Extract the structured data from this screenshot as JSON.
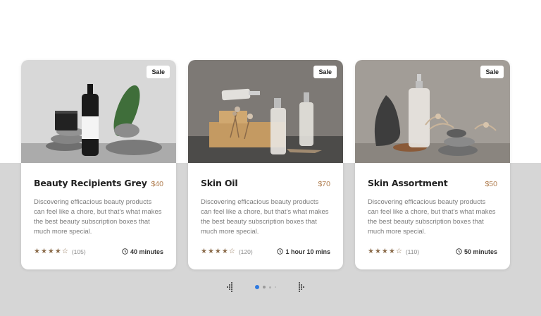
{
  "products": [
    {
      "title": "Beauty Recipients Grey",
      "price": "$40",
      "badge": "Sale",
      "description": "Discovering efficacious beauty products can feel like a chore, but that’s what makes the best beauty subscription boxes that much more special.",
      "stars": "★★★★☆",
      "rating_value": 4,
      "reviews": "(105)",
      "duration": "40 minutes"
    },
    {
      "title": "Skin Oil",
      "price": "$70",
      "badge": "Sale",
      "description": "Discovering efficacious beauty products can feel like a chore, but that’s what makes the best beauty subscription boxes that much more special.",
      "stars": "★★★★☆",
      "rating_value": 4,
      "reviews": "(120)",
      "duration": "1 hour 10 mins"
    },
    {
      "title": "Skin Assortment",
      "price": "$50",
      "badge": "Sale",
      "description": "Discovering efficacious beauty products can feel like a chore, but that’s what makes the best beauty subscription boxes that much more special.",
      "stars": "★★★★☆",
      "rating_value": 4,
      "reviews": "(110)",
      "duration": "50 minutes"
    }
  ],
  "carousel": {
    "active_index": 0,
    "page_count": 4
  },
  "colors": {
    "price": "#b07d4f",
    "star": "#8a6b4a",
    "active_dot": "#2f7ae0",
    "section_bg": "#d6d6d6"
  }
}
